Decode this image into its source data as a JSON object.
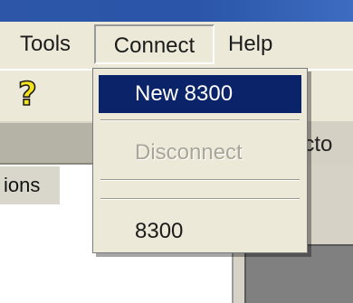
{
  "menubar": {
    "items": [
      {
        "label": "Tools"
      },
      {
        "label": "Connect"
      },
      {
        "label": "Help"
      }
    ]
  },
  "toolbar": {
    "icons": [
      "help-question-icon"
    ]
  },
  "panels": {
    "right_header_fragment": "ecto",
    "left_row_fragment": "ions"
  },
  "dropdown": {
    "items": [
      {
        "label": "New 8300",
        "state": "highlighted"
      },
      {
        "label": "Disconnect",
        "state": "disabled"
      },
      {
        "label": "8300",
        "state": "enabled"
      }
    ]
  },
  "colors": {
    "titlebar": "#2d56a8",
    "menu_background": "#ece9d8",
    "highlight": "#0b2469",
    "disabled_text": "#a8a698"
  }
}
